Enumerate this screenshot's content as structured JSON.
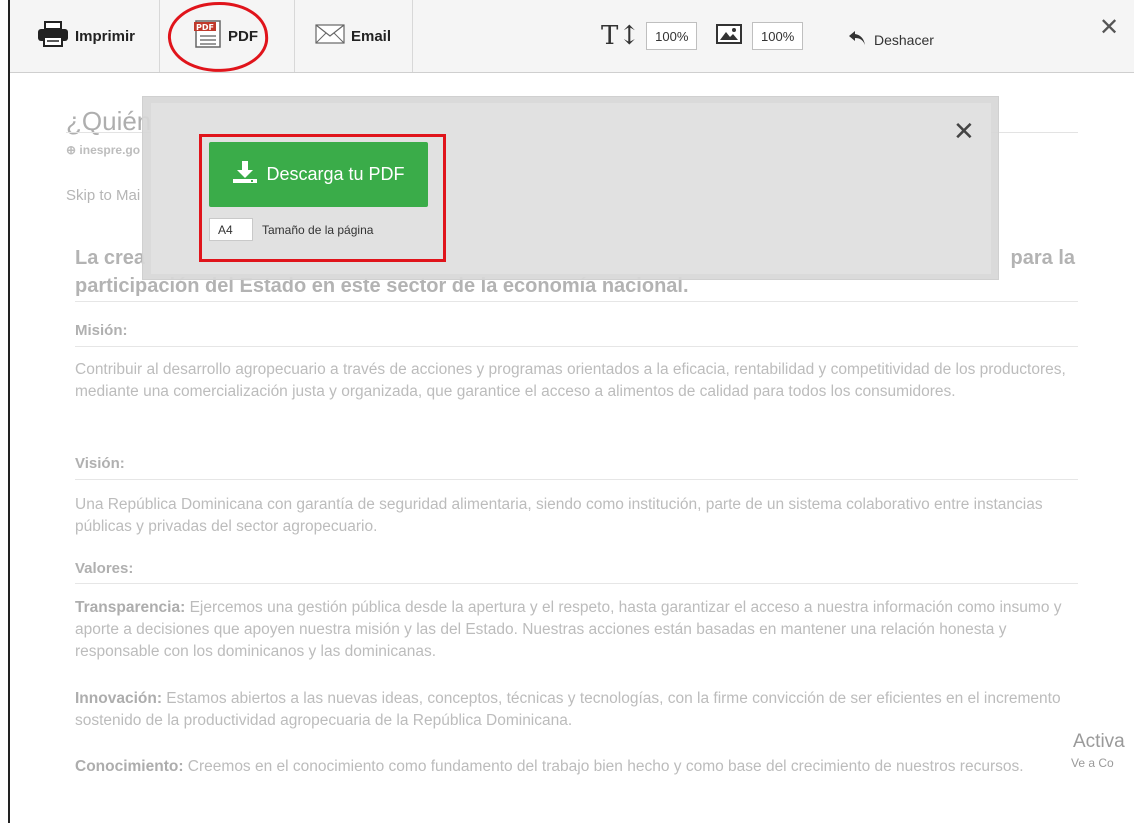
{
  "toolbar": {
    "print_label": "Imprimir",
    "pdf_label": "PDF",
    "email_label": "Email",
    "text_size_value": "100%",
    "image_size_value": "100%",
    "undo_label": "Deshacer",
    "close_symbol": "✕"
  },
  "page": {
    "title": "¿Quién",
    "source": "inespre.go",
    "skip_link": "Skip to Mai",
    "headline_left": "La crea",
    "headline_right": "para la",
    "headline_line2": "participación del Estado en este sector de la economía nacional.",
    "mision_title": "Misión:",
    "mision_text": "Contribuir al desarrollo agropecuario a través de acciones y programas orientados a la eficacia, rentabilidad y competitividad de los productores, mediante una comercialización justa y organizada, que garantice el acceso a alimentos de calidad para todos los consumidores.",
    "vision_title": "Visión:",
    "vision_text": "Una República Dominicana con garantía de seguridad alimentaria, siendo como institución, parte de un sistema colaborativo entre instancias públicas y privadas del sector agropecuario.",
    "valores_title": "Valores:",
    "values": [
      {
        "name": "Transparencia:",
        "text": " Ejercemos una gestión pública desde la apertura y el respeto, hasta garantizar el acceso a nuestra información como insumo y aporte a decisiones que apoyen nuestra misión y las del Estado. Nuestras acciones están basadas en mantener una relación honesta y responsable con los dominicanos y las dominicanas."
      },
      {
        "name": "Innovación:",
        "text": " Estamos abiertos a las nuevas ideas, conceptos, técnicas y tecnologías, con la firme convicción de ser eficientes en el incremento sostenido de la productividad agropecuaria de la República Dominicana."
      },
      {
        "name": "Conocimiento:",
        "text": " Creemos en el conocimiento como fundamento del trabajo bien hecho y como base del crecimiento de nuestros recursos."
      }
    ]
  },
  "pdf_dialog": {
    "download_label": "Descarga tu PDF",
    "page_size_value": "A4",
    "page_size_label": "Tamaño de la página",
    "close_symbol": "✕"
  },
  "watermark": {
    "line1": "Activa",
    "line2": "Ve a Co"
  },
  "colors": {
    "download_button": "#3aac49",
    "annotation": "#e0141b"
  }
}
